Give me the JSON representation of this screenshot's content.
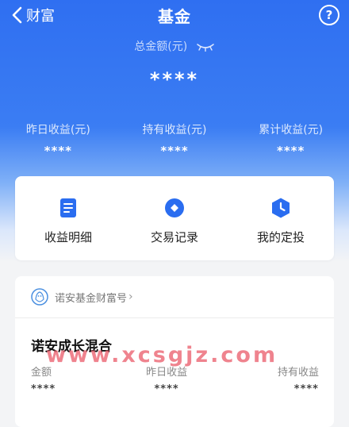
{
  "header": {
    "back_label": "财富",
    "title": "基金",
    "help_label": "?"
  },
  "summary": {
    "total_label": "总金额(元)",
    "total_value": "****",
    "stats": [
      {
        "label": "昨日收益(元)",
        "value": "****"
      },
      {
        "label": "持有收益(元)",
        "value": "****"
      },
      {
        "label": "累计收益(元)",
        "value": "****"
      }
    ]
  },
  "actions": [
    {
      "label": "收益明细",
      "icon": "document-icon"
    },
    {
      "label": "交易记录",
      "icon": "record-icon"
    },
    {
      "label": "我的定投",
      "icon": "clock-icon"
    }
  ],
  "fund_card": {
    "provider": "诺安基金财富号",
    "fund_name": "诺安成长混合",
    "columns": [
      {
        "label": "金额",
        "value": "****"
      },
      {
        "label": "昨日收益",
        "value": "****"
      },
      {
        "label": "持有收益",
        "value": "****"
      }
    ]
  },
  "watermark": "www.xcsgjz.com",
  "colors": {
    "primary": "#2f6ff1",
    "icon_blue": "#2a6df0",
    "watermark": "#ea606e"
  }
}
